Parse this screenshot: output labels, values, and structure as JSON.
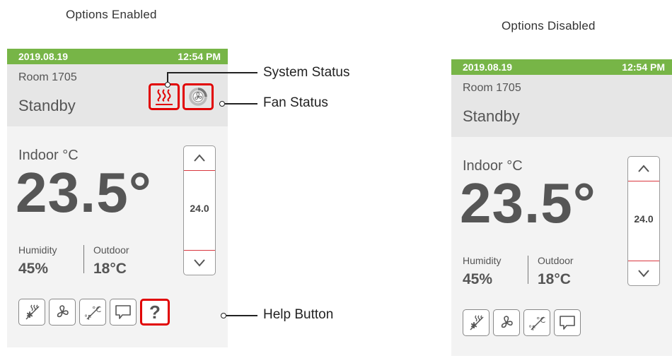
{
  "captions": {
    "enabled": "Options Enabled",
    "disabled": "Options Disabled"
  },
  "thermostat": {
    "date": "2019.08.19",
    "time": "12:54 PM",
    "room": "Room 1705",
    "mode": "Standby",
    "indoor_label": "Indoor °C",
    "indoor_temp": "23.5°",
    "setpoint": "24.0",
    "humidity_label": "Humidity",
    "humidity_value": "45%",
    "outdoor_label": "Outdoor",
    "outdoor_value": "18°C",
    "help_label": "?"
  },
  "callouts": {
    "system_status": "System Status",
    "fan_status": "Fan Status",
    "help_button": "Help Button"
  },
  "colors": {
    "status_bar": "#77b547",
    "highlight": "#e10000",
    "setpoint_line": "#d9363e"
  },
  "icons": [
    "heat-icon",
    "fan-icon",
    "cool-mode-icon",
    "fan-mode-icon",
    "unit-toggle-icon",
    "message-icon",
    "help-icon",
    "chevron-up-icon",
    "chevron-down-icon"
  ]
}
